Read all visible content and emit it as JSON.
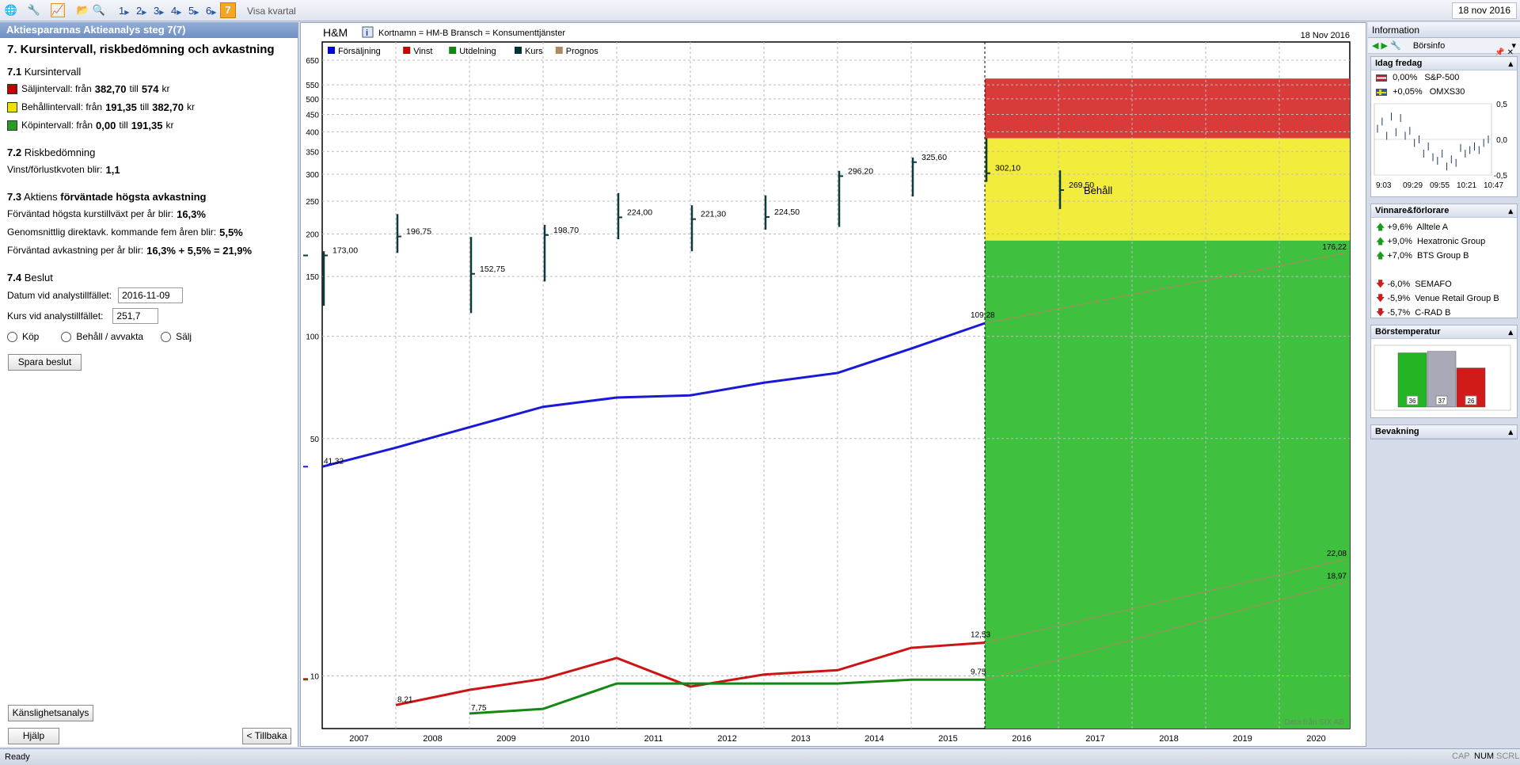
{
  "toolbar": {
    "steps": [
      "1",
      "2",
      "3",
      "4",
      "5",
      "6"
    ],
    "active_step": "7",
    "visa_kvartal": "Visa kvartal",
    "date": "18 nov 2016"
  },
  "left": {
    "header": "Aktiespararnas Aktieanalys steg 7(7)",
    "title": "7. Kursintervall, riskbedömning och avkastning",
    "s71": {
      "num": "7.1",
      "label": "Kursintervall",
      "rows": [
        {
          "color": "#c00000",
          "prefix": "Säljintervall: från",
          "from": "382,70",
          "mid": "till",
          "to": "574",
          "unit": "kr"
        },
        {
          "color": "#f0e000",
          "prefix": "Behållintervall: från",
          "from": "191,35",
          "mid": "till",
          "to": "382,70",
          "unit": "kr"
        },
        {
          "color": "#22a022",
          "prefix": "Köpintervall: från",
          "from": "0,00",
          "mid": "till",
          "to": "191,35",
          "unit": "kr"
        }
      ]
    },
    "s72": {
      "num": "7.2",
      "label": "Riskbedömning",
      "text": "Vinst/förlustkvoten blir:",
      "value": "1,1"
    },
    "s73": {
      "num": "7.3",
      "label_pre": "Aktiens",
      "label_bold": "förväntade högsta avkastning",
      "r1": {
        "text": "Förväntad högsta kurstillväxt per år blir:",
        "value": "16,3%"
      },
      "r2": {
        "text": "Genomsnittlig direktavk. kommande fem åren blir:",
        "value": "5,5%"
      },
      "r3": {
        "text": "Förväntad avkastning per år blir:",
        "value": "16,3% + 5,5% = 21,9%"
      }
    },
    "s74": {
      "num": "7.4",
      "label": "Beslut",
      "datum_label": "Datum vid analystillfället:",
      "datum_value": "2016-11-09",
      "kurs_label": "Kurs vid analystillfället:",
      "kurs_value": "251,7",
      "radios": [
        "Köp",
        "Behåll / avvakta",
        "Sälj"
      ],
      "save": "Spara beslut"
    },
    "btn_kanslighet": "Känslighetsanalys",
    "btn_hjalp": "Hjälp",
    "btn_tillbaka": "< Tillbaka"
  },
  "chart_header": {
    "company": "H&M",
    "info": "Kortnamn = HM-B   Bransch = Konsumenttjänster",
    "date": "18 Nov 2016",
    "source": "Data från SIX AB"
  },
  "chart_data": {
    "type": "line",
    "y_scale": "log",
    "ylim": [
      7,
      650
    ],
    "y_ticks": [
      10,
      50,
      100,
      150,
      200,
      250,
      300,
      350,
      400,
      450,
      500,
      550,
      650
    ],
    "categories": [
      "2007",
      "2008",
      "2009",
      "2010",
      "2011",
      "2012",
      "2013",
      "2014",
      "2015",
      "2016",
      "2017",
      "2018",
      "2019",
      "2020"
    ],
    "legend": [
      {
        "name": "Försäljning",
        "color": "#0000dd"
      },
      {
        "name": "Vinst",
        "color": "#cc0000"
      },
      {
        "name": "Utdelning",
        "color": "#118811"
      },
      {
        "name": "Kurs",
        "color": "#003333"
      },
      {
        "name": "Prognos",
        "color": "#b08860"
      }
    ],
    "zones": [
      {
        "from": 382.7,
        "to": 574,
        "color": "#d93a3a"
      },
      {
        "from": 191.35,
        "to": 382.7,
        "color": "#f2ec3d"
      },
      {
        "from": 0,
        "to": 191.35,
        "color": "#3fc03f",
        "label": "Behåll"
      }
    ],
    "series": [
      {
        "name": "Försäljning",
        "x": [
          2007,
          2008,
          2009,
          2010,
          2011,
          2012,
          2013,
          2014,
          2015,
          2016
        ],
        "values": [
          41.32,
          47,
          54,
          62,
          66,
          67,
          73,
          78,
          92,
          109.28
        ],
        "color": "#1a1ad6",
        "first_label": "41,32",
        "last_label": "109,28"
      },
      {
        "name": "Vinst",
        "x": [
          2008,
          2009,
          2010,
          2011,
          2012,
          2013,
          2014,
          2015,
          2016
        ],
        "values": [
          8.21,
          9.1,
          9.8,
          11.3,
          9.3,
          10.1,
          10.4,
          12.1,
          12.53
        ],
        "color": "#cc1414",
        "first_label": "8,21",
        "last_label": "12,53"
      },
      {
        "name": "Utdelning",
        "x": [
          2009,
          2010,
          2011,
          2012,
          2013,
          2014,
          2015,
          2016
        ],
        "values": [
          7.75,
          8.0,
          9.5,
          9.5,
          9.5,
          9.5,
          9.75,
          9.75
        ],
        "color": "#138813",
        "first_label": "7,75",
        "last_label": "9,75"
      }
    ],
    "forecast": [
      {
        "from": 109.28,
        "to": 176.22,
        "label": "176,22"
      },
      {
        "from": 12.53,
        "to": 22.08,
        "label": "22,08"
      },
      {
        "from": 9.75,
        "to": 18.97,
        "label": "18,97"
      }
    ],
    "kurs": [
      {
        "x": 2007,
        "low": 123,
        "high": 178,
        "close": 173.0,
        "label": "173,00"
      },
      {
        "x": 2008,
        "low": 176,
        "high": 229,
        "close": 196.75,
        "label": "196,75"
      },
      {
        "x": 2009,
        "low": 117,
        "high": 196,
        "close": 152.75,
        "label": "152,75"
      },
      {
        "x": 2010,
        "low": 145,
        "high": 213,
        "close": 198.7,
        "label": "198,70"
      },
      {
        "x": 2011,
        "low": 193,
        "high": 264,
        "close": 224.0,
        "label": "224,00"
      },
      {
        "x": 2012,
        "low": 178,
        "high": 243,
        "close": 221.3,
        "label": "221,30"
      },
      {
        "x": 2013,
        "low": 206,
        "high": 260,
        "close": 224.5,
        "label": "224,50"
      },
      {
        "x": 2014,
        "low": 210,
        "high": 307,
        "close": 296.2,
        "label": "296,20"
      },
      {
        "x": 2015,
        "low": 258,
        "high": 336,
        "close": 325.6,
        "label": "325,60"
      },
      {
        "x": 2016,
        "low": 285,
        "high": 383,
        "close": 302.1,
        "label": "302,10"
      },
      {
        "x": 2017,
        "low": 237,
        "high": 308,
        "close": 269.5,
        "label": "269,50"
      }
    ]
  },
  "right": {
    "header": "Information",
    "borsinfo": "Börsinfo",
    "idag": {
      "title": "Idag fredag",
      "items": [
        {
          "flag": "us",
          "value": "0,00%",
          "name": "S&P-500"
        },
        {
          "flag": "se",
          "value": "+0,05%",
          "name": "OMXS30"
        }
      ],
      "mini_ticks": [
        "9:03",
        "09:29",
        "09:55",
        "10:21",
        "10:47"
      ],
      "mini_y": [
        "0,5",
        "0,0",
        "-0,5"
      ],
      "mini_values": [
        0.15,
        0.25,
        0.05,
        0.32,
        0.1,
        0.3,
        0.05,
        0.12,
        -0.05,
        0.0,
        -0.2,
        -0.1,
        -0.25,
        -0.3,
        -0.2,
        -0.38,
        -0.28,
        -0.33,
        -0.12,
        -0.2,
        -0.15,
        -0.1,
        -0.15,
        -0.05,
        0.0
      ]
    },
    "vinnare": {
      "title": "Vinnare&förlorare",
      "up": [
        {
          "value": "+9,6%",
          "name": "Alltele A"
        },
        {
          "value": "+9,0%",
          "name": "Hexatronic Group"
        },
        {
          "value": "+7,0%",
          "name": "BTS Group B"
        }
      ],
      "down": [
        {
          "value": "-6,0%",
          "name": "SEMAFO"
        },
        {
          "value": "-5,9%",
          "name": "Venue Retail Group B"
        },
        {
          "value": "-5,7%",
          "name": "C-RAD B"
        }
      ]
    },
    "temp": {
      "title": "Börstemperatur",
      "bars": [
        {
          "value": 36,
          "label": "36",
          "color": "#22b422"
        },
        {
          "value": 37,
          "label": "37",
          "color": "#a8aab8"
        },
        {
          "value": 26,
          "label": "26",
          "color": "#d11a1a"
        }
      ]
    },
    "bevakning": "Bevakning"
  },
  "status": {
    "text": "Ready",
    "indicators": [
      "CAP",
      "NUM",
      "SCRL"
    ]
  }
}
